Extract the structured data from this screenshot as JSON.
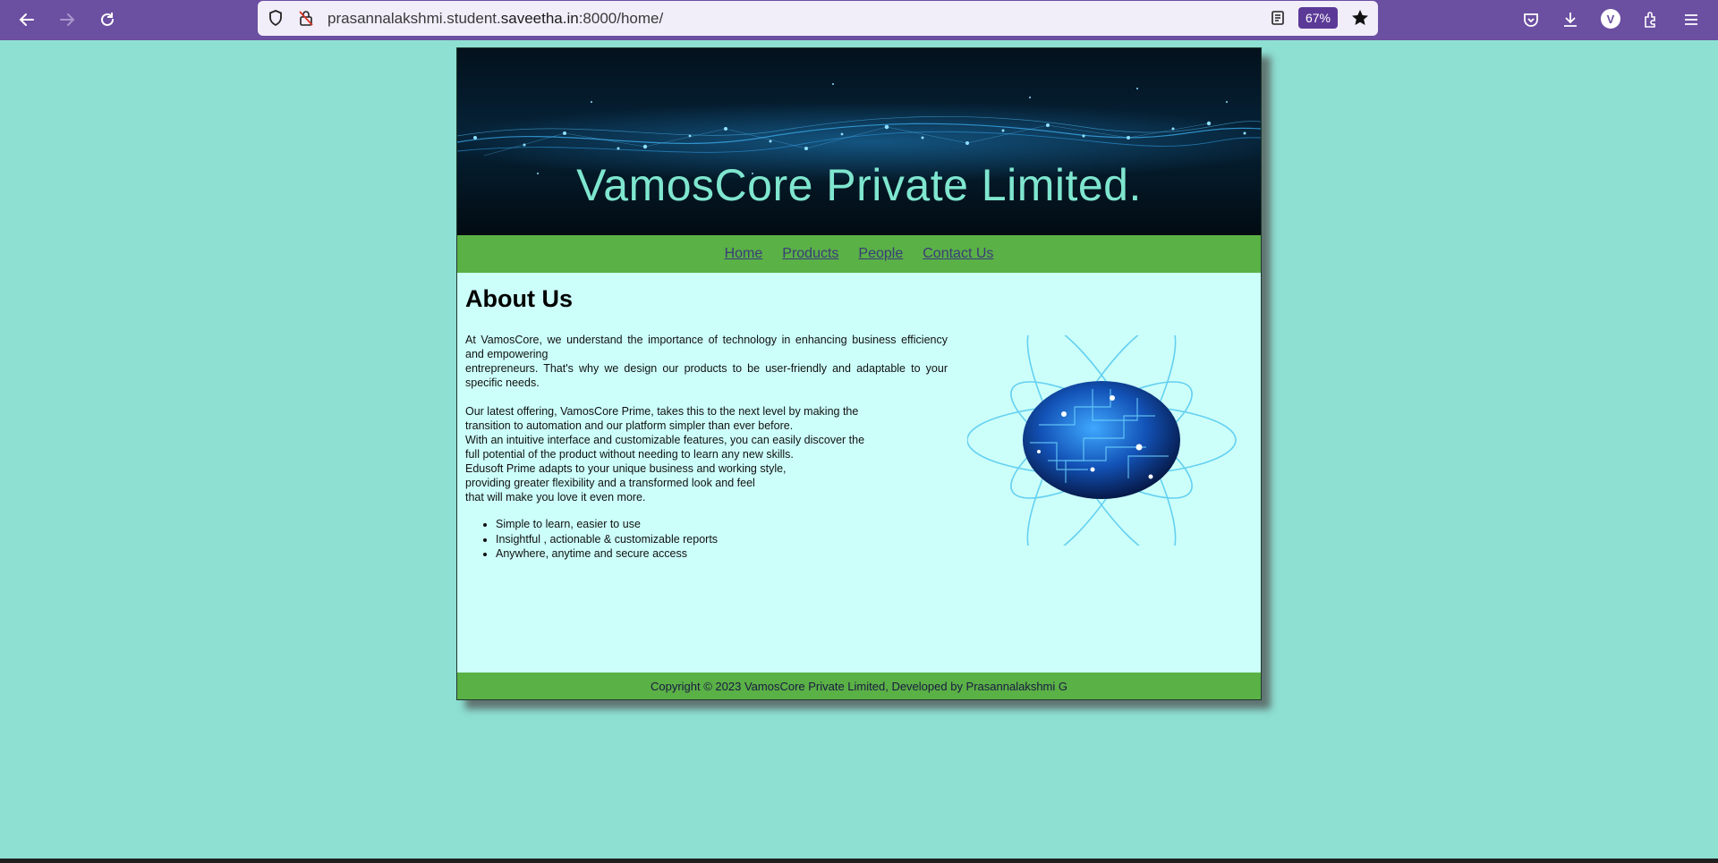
{
  "browser": {
    "url_prefix": "prasannalakshmi.student.",
    "url_domain": "saveetha.in",
    "url_suffix": ":8000/home/",
    "zoom": "67%",
    "profile_initial": "V"
  },
  "site": {
    "banner_title": "VamosCore Private Limited.",
    "nav": [
      "Home",
      "Products",
      "People",
      "Contact Us"
    ],
    "about": {
      "heading": "About Us",
      "para1_line1": "At VamosCore, we understand the importance of technology in enhancing business efficiency and empowering",
      "para1_line2": "entrepreneurs. That's why we design our products to be user-friendly and adaptable to your specific needs.",
      "para2_lines": [
        "Our latest offering, VamosCore Prime, takes this to the next level by making the",
        "transition to automation and our platform simpler than ever before.",
        "With an intuitive interface and customizable features, you can easily discover the",
        "full potential of the product without needing to learn any new skills.",
        "Edusoft Prime adapts to your unique business and working style,",
        "providing greater flexibility and a transformed look and feel",
        "that will make you love it even more."
      ],
      "features": [
        "Simple to learn, easier to use",
        "Insightful , actionable & customizable reports",
        "Anywhere, anytime and secure access"
      ]
    },
    "footer": "Copyright © 2023 VamosCore Private Limited, Developed by Prasannalakshmi G"
  },
  "colors": {
    "page_bg": "#8ee0d3",
    "toolbar": "#6b4fa1",
    "nav_green": "#5ab146",
    "content_bg": "#ccfffa",
    "banner_text": "#7fe6cf"
  }
}
